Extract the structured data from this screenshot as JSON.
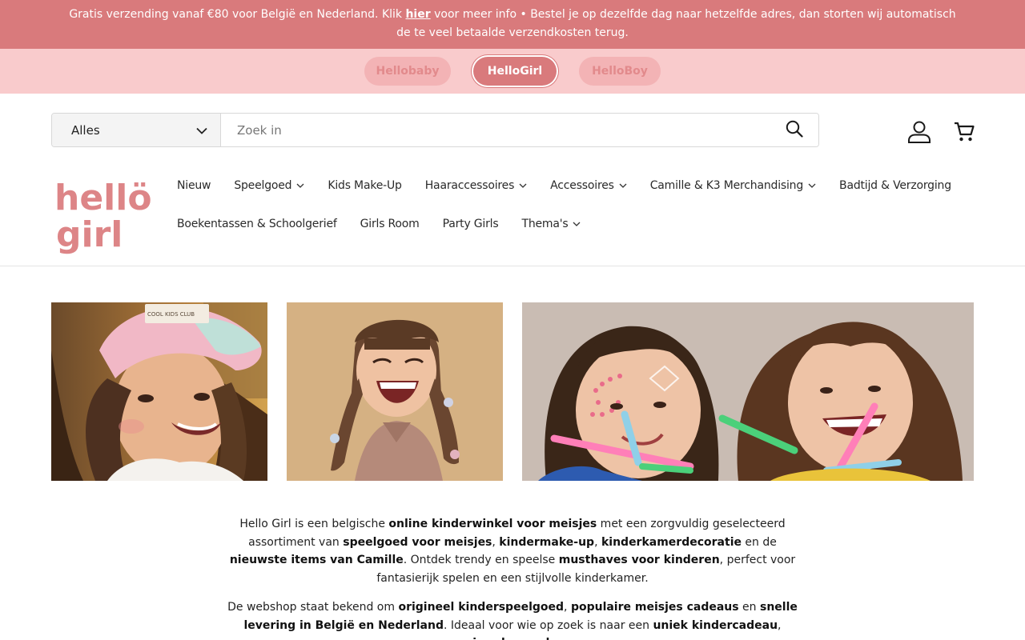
{
  "announcement": {
    "before_link": "Gratis verzending vanaf €80 voor België en Nederland. Klik ",
    "link": "hier",
    "after_link": " voor meer info • Bestel je op dezelfde dag naar hetzelfde adres, dan storten wij automatisch de te veel betaalde verzendkosten terug."
  },
  "stores": [
    {
      "label": "Hellobaby",
      "active": false
    },
    {
      "label": "HelloGirl",
      "active": true
    },
    {
      "label": "HelloBoy",
      "active": false
    }
  ],
  "search": {
    "category": "Alles",
    "placeholder": "Zoek in"
  },
  "logo": {
    "line1": "hellö",
    "line2": "girl"
  },
  "nav": {
    "row1": [
      "Nieuw",
      "Speelgoed",
      "Kids Make-Up",
      "Haaraccessoires",
      "Accessoires",
      "Camille & K3 Merchandising",
      "Badtijd & Verzorging"
    ],
    "row2": [
      "Boekentassen & Schoolgerief",
      "Girls Room",
      "Party Girls",
      "Thema's"
    ]
  },
  "hero_cap_text": "COOL KIDS CLUB",
  "intro": {
    "p1": [
      {
        "t": "Hello Girl is een belgische ",
        "b": false
      },
      {
        "t": "online kinderwinkel voor meisjes",
        "b": true
      },
      {
        "t": " met een zorgvuldig geselecteerd assortiment van ",
        "b": false
      },
      {
        "t": "speelgoed voor meisjes",
        "b": true
      },
      {
        "t": ", ",
        "b": false
      },
      {
        "t": "kindermake-up",
        "b": true
      },
      {
        "t": ", ",
        "b": false
      },
      {
        "t": "kinderkamerdecoratie",
        "b": true
      },
      {
        "t": " en de ",
        "b": false
      },
      {
        "t": "nieuwste items van Camille",
        "b": true
      },
      {
        "t": ". Ontdek trendy en speelse ",
        "b": false
      },
      {
        "t": "musthaves voor kinderen",
        "b": true
      },
      {
        "t": ", perfect voor fantasierijk spelen en een stijlvolle kinderkamer.",
        "b": false
      }
    ],
    "p2": [
      {
        "t": "De webshop staat bekend om ",
        "b": false
      },
      {
        "t": "origineel kinderspeelgoed",
        "b": true
      },
      {
        "t": ", ",
        "b": false
      },
      {
        "t": "populaire meisjes cadeaus",
        "b": true
      },
      {
        "t": " en ",
        "b": false
      },
      {
        "t": "snelle levering in België en Nederland",
        "b": true
      },
      {
        "t": ". Ideaal voor wie op zoek is naar een ",
        "b": false
      },
      {
        "t": "uniek kindercadeau",
        "b": true
      },
      {
        "t": ", ",
        "b": false
      },
      {
        "t": "verjaardagscadeau",
        "b": true
      }
    ]
  }
}
